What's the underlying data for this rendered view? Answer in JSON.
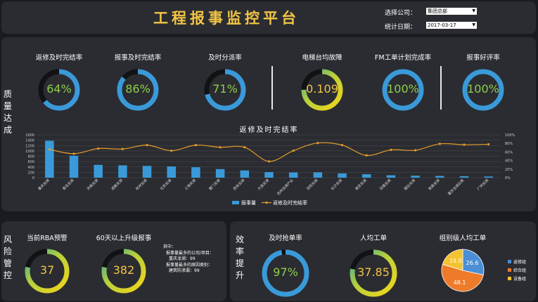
{
  "header": {
    "title": "工程报事监控平台",
    "company_label": "选择公司：",
    "company_value": "集团总部",
    "date_label": "统计日期：",
    "date_value": "2017-03-17"
  },
  "sections": {
    "quality": "质量达成",
    "risk": "风险管控",
    "efficiency": "效率提升"
  },
  "quality_gauges": [
    {
      "title": "返修及时完结率",
      "value": "64%",
      "pct": 64,
      "color": "#3a9ad9",
      "text_color": "#8ccf4d"
    },
    {
      "title": "报事及时完结率",
      "value": "86%",
      "pct": 86,
      "color": "#3a9ad9",
      "text_color": "#8ccf4d"
    },
    {
      "title": "及时分派率",
      "value": "71%",
      "pct": 71,
      "color": "#3a9ad9",
      "text_color": "#8ccf4d"
    },
    {
      "title": "电梯台均故障",
      "value": "0.109",
      "pct": 75,
      "color": "gradient",
      "text_color": "#f3c545"
    },
    {
      "title": "FM工单计划完成率",
      "value": "100%",
      "pct": 100,
      "color": "#3a9ad9",
      "text_color": "#8ccf4d"
    },
    {
      "title": "报事好评率",
      "value": "100%",
      "pct": 100,
      "color": "#3a9ad9",
      "text_color": "#8ccf4d"
    }
  ],
  "chart_data": {
    "type": "bar",
    "title": "返修及时完结率",
    "categories": [
      "重庆龙湖",
      "青岛龙湖",
      "济南龙湖",
      "成都龙湖",
      "杭州龙湖",
      "北京龙湖",
      "上海龙湖",
      "厦门龙湖",
      "西安龙湖",
      "大连龙湖",
      "苏州龙湖产业",
      "沈阳龙湖",
      "长沙龙湖",
      "南京龙湖",
      "无锡龙湖",
      "烟台龙湖",
      "南昌龙湖",
      "重庆龙湖云南",
      "广州龙湖"
    ],
    "series": [
      {
        "name": "报事量",
        "type": "bar",
        "axis": "left",
        "values": [
          1380,
          820,
          480,
          460,
          440,
          420,
          390,
          320,
          270,
          210,
          195,
          200,
          160,
          130,
          90,
          75,
          65,
          55,
          45
        ]
      },
      {
        "name": "返修及时完结率",
        "type": "line",
        "axis": "right",
        "values": [
          66,
          56,
          68,
          67,
          76,
          63,
          76,
          71,
          71,
          38,
          63,
          81,
          76,
          52,
          65,
          64,
          79,
          77,
          78
        ]
      }
    ],
    "ylim_left": [
      0,
      1600
    ],
    "yticks_left": [
      0,
      200,
      400,
      600,
      800,
      1000,
      1200,
      1400,
      1600
    ],
    "ylim_right": [
      0,
      100
    ],
    "yticks_right": [
      "0%",
      "20%",
      "40%",
      "60%",
      "80%",
      "100%"
    ],
    "legend_position": "bottom",
    "grid": true,
    "bar_color": "#3a9ad9",
    "line_color": "#e39b2c"
  },
  "risk": {
    "gauges": [
      {
        "title": "当前RBA预警",
        "value": "37",
        "pct": 78
      },
      {
        "title": "60天以上升级报事",
        "value": "382",
        "pct": 78
      }
    ],
    "note_lines": [
      "其中：",
      "报事量最多的公司/项目：",
      "重庆龙湖：99",
      "报事量最多的原因类别：",
      "建筑防渗漏：99"
    ]
  },
  "efficiency": {
    "gauges": [
      {
        "title": "及时抢单率",
        "value": "97%",
        "pct": 97,
        "color": "#3a9ad9",
        "text_color": "#8ccf4d"
      },
      {
        "title": "人均工单",
        "value": "37.85",
        "pct": 78,
        "color": "gradient",
        "text_color": "#f3c545"
      }
    ],
    "pie": {
      "title": "组别级人均工单",
      "slices": [
        {
          "name": "返修组",
          "value": 26.6,
          "color": "#4a8fd6"
        },
        {
          "name": "综合组",
          "value": 48.1,
          "color": "#ee7b2a"
        },
        {
          "name": "设备组",
          "value": 19.0,
          "color": "#f3c22f"
        }
      ]
    }
  }
}
